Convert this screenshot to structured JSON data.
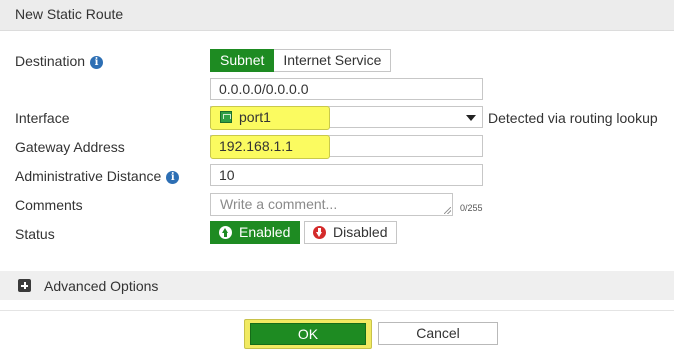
{
  "dialog": {
    "title": "New Static Route"
  },
  "form": {
    "destination": {
      "label": "Destination",
      "options": [
        "Subnet",
        "Internet Service"
      ],
      "selected": "Subnet",
      "value": "0.0.0.0/0.0.0.0"
    },
    "interface": {
      "label": "Interface",
      "value": "port1",
      "note": "Detected via routing lookup"
    },
    "gateway": {
      "label": "Gateway Address",
      "value": "192.168.1.1"
    },
    "distance": {
      "label": "Administrative Distance",
      "value": "10"
    },
    "comments": {
      "label": "Comments",
      "placeholder": "Write a comment...",
      "counter": "0/255"
    },
    "status": {
      "label": "Status",
      "enabled_label": "Enabled",
      "disabled_label": "Disabled",
      "selected": "Enabled"
    }
  },
  "advanced": {
    "label": "Advanced Options"
  },
  "buttons": {
    "ok": "OK",
    "cancel": "Cancel"
  },
  "colors": {
    "accent_green": "#1e8b22",
    "highlight_yellow": "#fbfb60",
    "info_blue": "#2d6fb4",
    "disabled_red": "#d42b2b"
  },
  "icons": [
    "info-icon",
    "port-icon",
    "chevron-down-icon",
    "enabled-icon",
    "disabled-icon",
    "plus-icon"
  ]
}
